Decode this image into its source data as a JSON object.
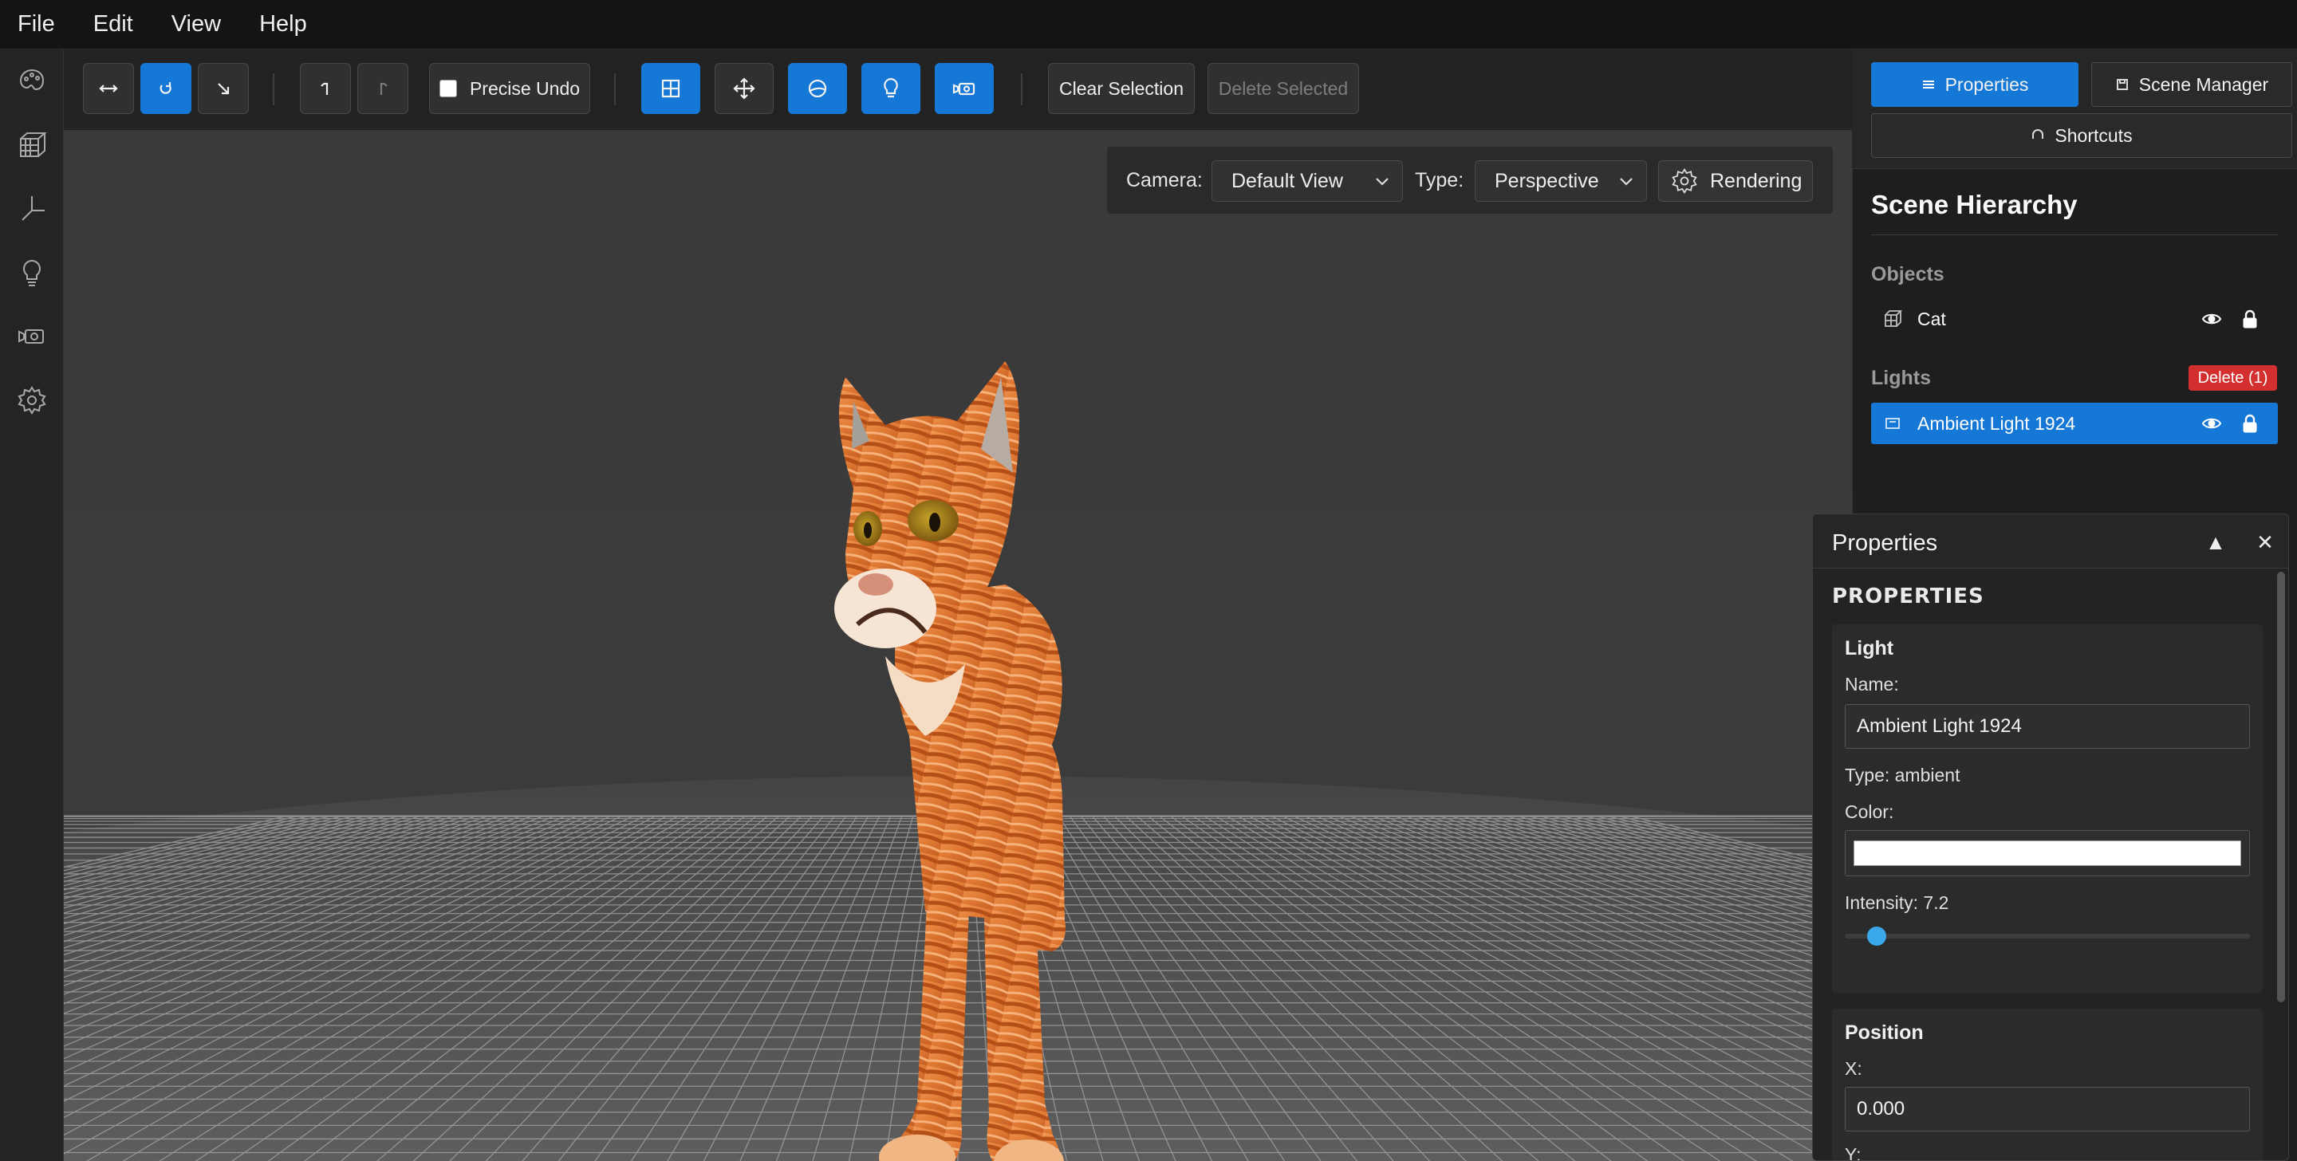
{
  "menu": [
    "File",
    "Edit",
    "View",
    "Help"
  ],
  "toolbar": {
    "precise_undo_label": "Precise Undo",
    "clear_selection_label": "Clear Selection",
    "delete_selected_label": "Delete Selected"
  },
  "camera": {
    "camera_label": "Camera:",
    "camera_value": "Default View",
    "type_label": "Type:",
    "type_value": "Perspective",
    "rendering_label": "Rendering"
  },
  "right_tabs": {
    "properties": "Properties",
    "scene_manager": "Scene Manager",
    "shortcuts": "Shortcuts"
  },
  "hierarchy": {
    "title": "Scene Hierarchy",
    "objects_title": "Objects",
    "objects": [
      {
        "name": "Cat"
      }
    ],
    "lights_title": "Lights",
    "delete_badge": "Delete (1)",
    "lights": [
      {
        "name": "Ambient Light 1924"
      }
    ]
  },
  "properties_panel": {
    "title": "Properties",
    "heading": "PROPERTIES",
    "collapse_glyph": "▲",
    "close_glyph": "✕",
    "light": {
      "section": "Light",
      "name_label": "Name:",
      "name_value": "Ambient Light 1924",
      "type_text": "Type: ambient",
      "color_label": "Color:",
      "color_value": "#ffffff",
      "intensity_label": "Intensity: 7.2",
      "intensity_fraction": 0.05
    },
    "position": {
      "section": "Position",
      "x_label": "X:",
      "x_value": "0.000",
      "y_label": "Y:"
    }
  },
  "colors": {
    "accent": "#1577d6",
    "danger": "#d32f2f",
    "slider": "#3aa8ea"
  }
}
